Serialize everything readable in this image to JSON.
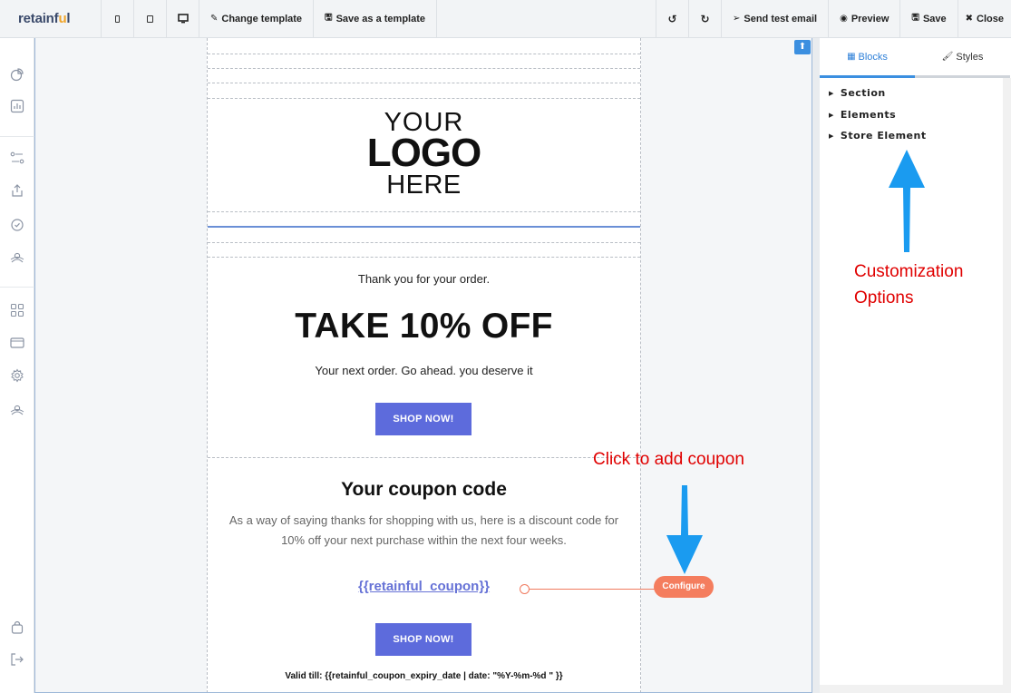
{
  "app": {
    "brand_main": "retainf",
    "brand_accent": "u",
    "brand_end": "l"
  },
  "toolbar": {
    "change_template": "Change template",
    "save_as_template": "Save as a template",
    "send_test_email": "Send test email",
    "preview": "Preview",
    "save": "Save",
    "close": "Close"
  },
  "email": {
    "logo_line1": "YOUR",
    "logo_line2": "LOGO",
    "logo_line3": "HERE",
    "thanks": "Thank you for your order.",
    "headline": "TAKE 10% OFF",
    "subline": "Your next order. Go ahead. you deserve it",
    "shop_button": "SHOP NOW!",
    "coupon_title": "Your coupon code",
    "coupon_desc": "As a way of saying thanks for shopping with us, here is a discount code for 10% off your next purchase within the next four weeks.",
    "coupon_code": "{{retainful_coupon}}",
    "shop_button_2": "SHOP NOW!",
    "valid_till": "Valid till: {{retainful_coupon_expiry_date | date: \"%Y-%m-%d \" }}"
  },
  "configure_label": "Configure",
  "panel": {
    "tab_blocks": "Blocks",
    "tab_styles": "Styles",
    "categories": [
      "Section",
      "Elements",
      "Store Element"
    ]
  },
  "annotations": {
    "coupon_hint": "Click to add coupon",
    "options_hint_1": "Customization",
    "options_hint_2": "Options"
  },
  "colors": {
    "accent": "#3b8fe0",
    "button": "#5d6bdc",
    "configure": "#f47d5e",
    "annotation": "#e00000",
    "arrow": "#1a9bf0"
  }
}
